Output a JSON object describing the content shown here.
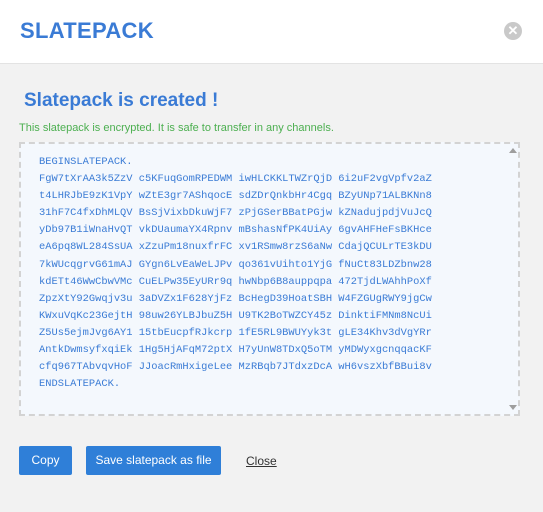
{
  "header": {
    "title": "SLATEPACK",
    "close_glyph": "✕"
  },
  "main": {
    "created_title": "Slatepack is created !",
    "info_text": "This slatepack is encrypted. It is safe to transfer in any channels.",
    "slatepack_lines": [
      "BEGINSLATEPACK.",
      "FgW7tXrAA3k5ZzV c5KFuqGomRPEDWM iwHLCKKLTWZrQjD 6i2uF2vgVpfv2aZ",
      "t4LHRJbE9zK1VpY wZtE3gr7AShqocE sdZDrQnkbHr4Cgq BZyUNp71ALBKNn8",
      "31hF7C4fxDhMLQV BsSjVixbDkuWjF7 zPjGSerBBatPGjw kZNadujpdjVuJcQ",
      "yDb97B1iWnaHvQT vkDUaumaYX4Rpnv mBshasNfPK4UiAy 6gvAHFHeFsBKHce",
      "eA6pq8WL284SsUA xZzuPm18nuxfrFC xv1RSmw8rzS6aNw CdajQCULrTE3kDU",
      "7kWUcqgrvG61mAJ GYgn6LvEaWeLJPv qo361vUihto1YjG fNuCt83LDZbnw28",
      "kdETt46WwCbwVMc CuELPw35EyURr9q hwNbp6B8auppqpa 472TjdLWAhhPoXf",
      "ZpzXtY92Gwqjv3u 3aDVZx1F628YjFz BcHegD39HoatSBH W4FZGUgRWY9jgCw",
      "KWxuVqKc23GejtH 98uw26YLBJbuZ5H U9TK2BoTWZCY45z DinktiFMNm8NcUi",
      "Z5Us5ejmJvg6AY1 15tbEucpfRJkcrp 1fE5RL9BWUYyk3t gLE34Khv3dVgYRr",
      "AntkDwmsyfxqiEk 1Hg5HjAFqM72ptX H7yUnW8TDxQ5oTM yMDWyxgcnqqacKF",
      "cfq967TAbvqvHoF JJoacRmHxigeLee MzRBqb7JTdxzDcA wH6vszXbfBBui8v",
      "ENDSLATEPACK."
    ]
  },
  "footer": {
    "copy_label": "Copy",
    "save_label": "Save slatepack as file",
    "close_label": "Close"
  }
}
